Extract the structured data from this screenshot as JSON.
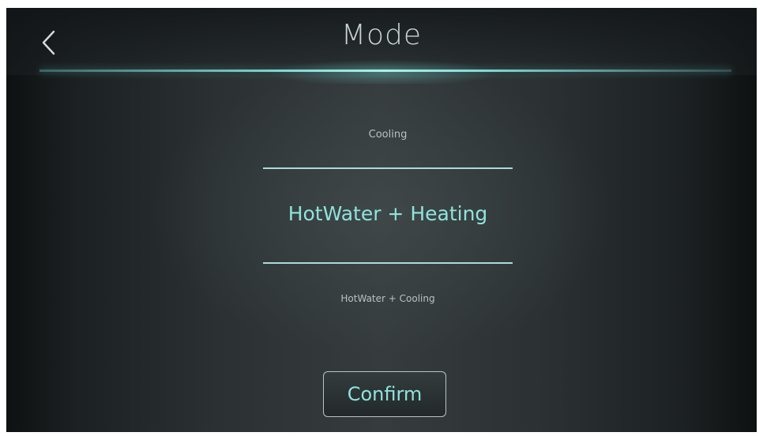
{
  "header": {
    "title": "Mode",
    "back_icon": "chevron-left-icon"
  },
  "mode_picker": {
    "options": [
      "Cooling",
      "HotWater + Heating",
      "HotWater + Cooling"
    ],
    "selected": "HotWater + Heating"
  },
  "confirm_label": "Confirm",
  "colors": {
    "accent": "#8fe3dc",
    "divider": "#a9dcd8",
    "title_text": "#c8d4d4",
    "background": "#2b3133"
  }
}
